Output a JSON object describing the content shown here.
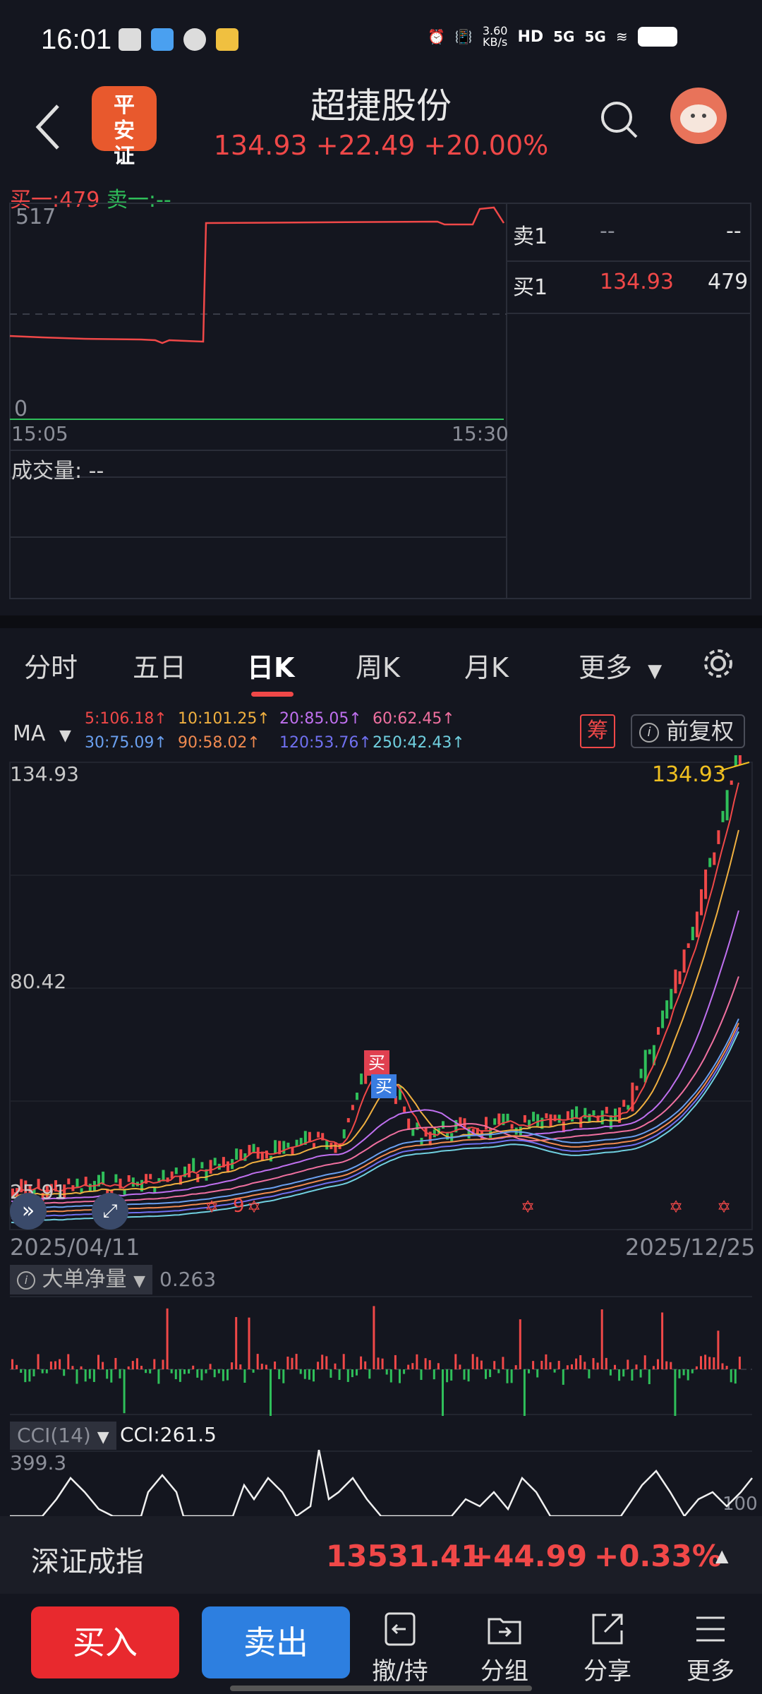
{
  "status": {
    "time": "16:01",
    "net_speed_top": "3.60",
    "net_speed_bottom": "KB/s",
    "hd": "HD",
    "sig1": "5G",
    "sig2": "5G"
  },
  "header": {
    "broker_logo": "平安证券",
    "title": "超捷股份",
    "price": "134.93",
    "change": "+22.49",
    "change_pct": "+20.00%"
  },
  "intraday": {
    "bid_label": "买一:479",
    "ask_label": "卖一:--",
    "y_max": "517",
    "y_min": "0",
    "x_start": "15:05",
    "x_end": "15:30",
    "volume_label": "成交量: --",
    "book": {
      "sell1_label": "卖1",
      "sell1_price": "--",
      "sell1_qty": "--",
      "buy1_label": "买1",
      "buy1_price": "134.93",
      "buy1_qty": "479"
    }
  },
  "tabs": [
    "分时",
    "五日",
    "日K",
    "周K",
    "月K",
    "更多"
  ],
  "active_tab": "日K",
  "ma": {
    "label": "MA",
    "row1": [
      {
        "text": "5:106.18↑",
        "color": "#f04848"
      },
      {
        "text": "10:101.25↑",
        "color": "#f0b040"
      },
      {
        "text": "20:85.05↑",
        "color": "#c070f0"
      },
      {
        "text": "60:62.45↑",
        "color": "#f070a0"
      }
    ],
    "row2": [
      {
        "text": "30:75.09↑",
        "color": "#6aa0f0"
      },
      {
        "text": "90:58.02↑",
        "color": "#f08a50"
      },
      {
        "text": "120:53.76↑",
        "color": "#7070f0"
      },
      {
        "text": "250:42.43↑",
        "color": "#70d0e0"
      }
    ],
    "chip_label": "筹",
    "adjust_label": "前复权"
  },
  "kchart": {
    "y_top": "134.93",
    "y_mid": "80.42",
    "y_bottom": "25.91",
    "last_price": "134.93",
    "x_start": "2025/04/11",
    "x_end": "2025/12/25",
    "buy_marker_1": "买",
    "buy_marker_2": "买",
    "small_marker": "9"
  },
  "flow": {
    "label": "大单净量",
    "value": "0.263"
  },
  "cci": {
    "label": "CCI(14)",
    "value": "CCI:261.5",
    "y_top": "399.3",
    "y_right": "100"
  },
  "index": {
    "name": "深证成指",
    "value": "13531.41",
    "change": "+44.99",
    "pct": "+0.33%"
  },
  "bottom": {
    "buy": "买入",
    "sell": "卖出",
    "tools": [
      "撤/持",
      "分组",
      "分享",
      "更多"
    ]
  }
}
